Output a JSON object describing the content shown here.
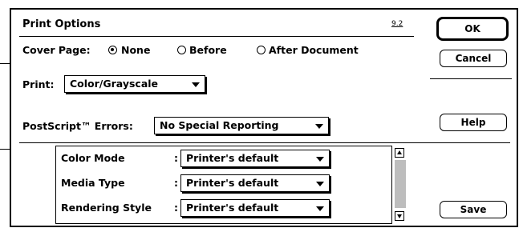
{
  "dialog": {
    "title": "Print Options",
    "version": "9.2"
  },
  "cover_page": {
    "label": "Cover Page:",
    "options": [
      "None",
      "Before",
      "After Document"
    ],
    "selected": "None"
  },
  "print": {
    "label": "Print:",
    "value": "Color/Grayscale"
  },
  "ghost_text": "",
  "postscript_errors": {
    "label": "PostScript™ Errors:",
    "value": "No Special Reporting"
  },
  "settings": [
    {
      "label": "Color Mode",
      "value": "Printer's default"
    },
    {
      "label": "Media Type",
      "value": "Printer's default"
    },
    {
      "label": "Rendering Style",
      "value": "Printer's default"
    }
  ],
  "buttons": {
    "ok": "OK",
    "cancel": "Cancel",
    "help": "Help",
    "save": "Save"
  }
}
